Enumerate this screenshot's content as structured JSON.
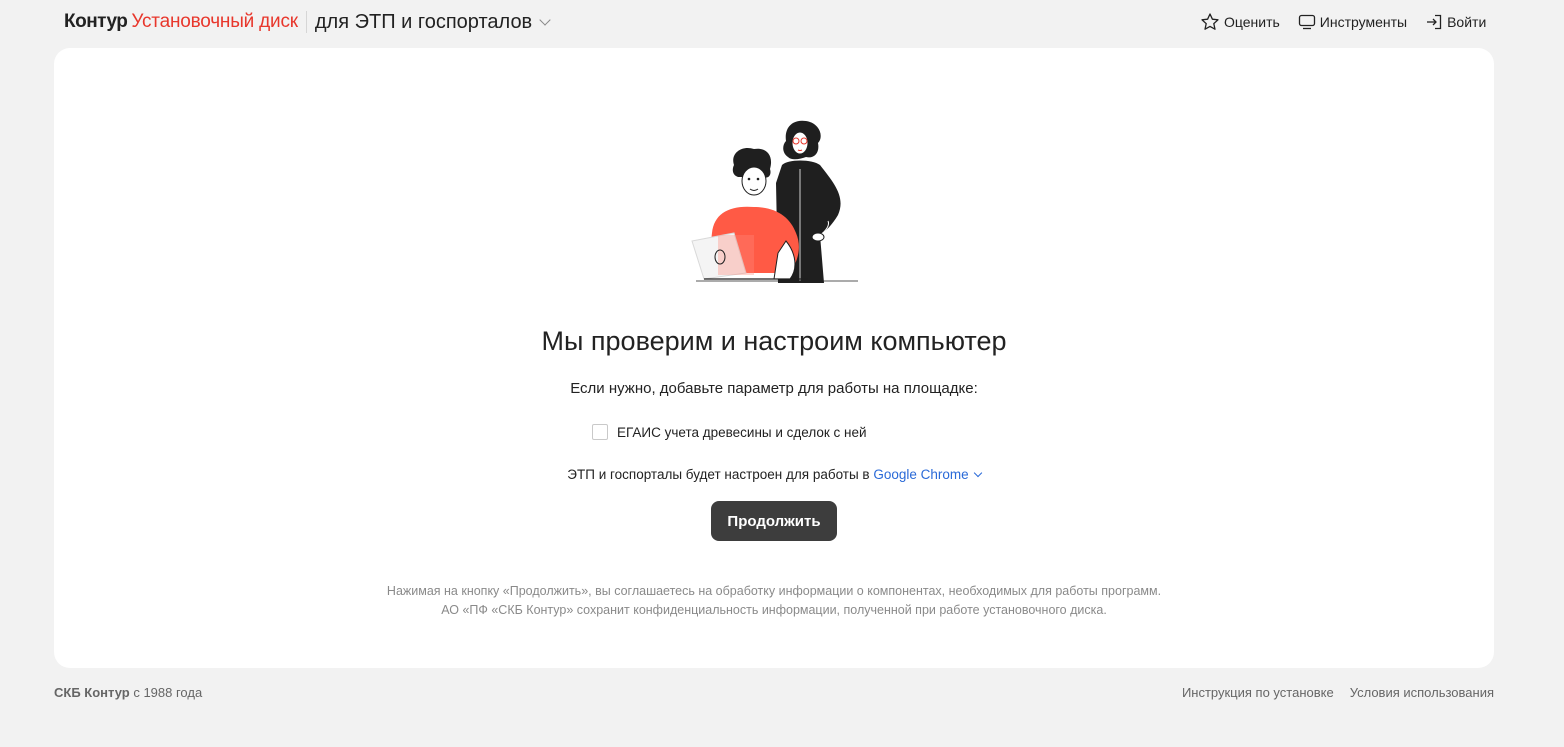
{
  "header": {
    "logo": "Контур",
    "product": "Установочный диск",
    "section": "для ЭТП и госпорталов",
    "actions": {
      "rate": "Оценить",
      "tools": "Инструменты",
      "login": "Войти"
    }
  },
  "main": {
    "title": "Мы проверим и настроим компьютер",
    "subtitle": "Если нужно, добавьте параметр для работы на площадке:",
    "checkbox_label": "ЕГАИС учета древесины и сделок с ней",
    "browser_prefix": "ЭТП и госпорталы будет настроен для работы в",
    "browser_name": "Google Chrome",
    "continue_label": "Продолжить",
    "disclaimer_line1": "Нажимая на кнопку «Продолжить», вы соглашаетесь на обработку информации о компонентах, необходимых для работы программ.",
    "disclaimer_line2": "АО «ПФ «СКБ Контур» сохранит конфиденциальность информации, полученной при работе установочного диска."
  },
  "footer": {
    "company": "СКБ Контур",
    "since": "с 1988 года",
    "links": [
      "Инструкция по установке",
      "Условия использования"
    ]
  },
  "colors": {
    "accent_red": "#e8372c",
    "link_blue": "#2a6ad8",
    "button_dark": "#3d3d3d",
    "shirt_red": "#ff5a45"
  }
}
